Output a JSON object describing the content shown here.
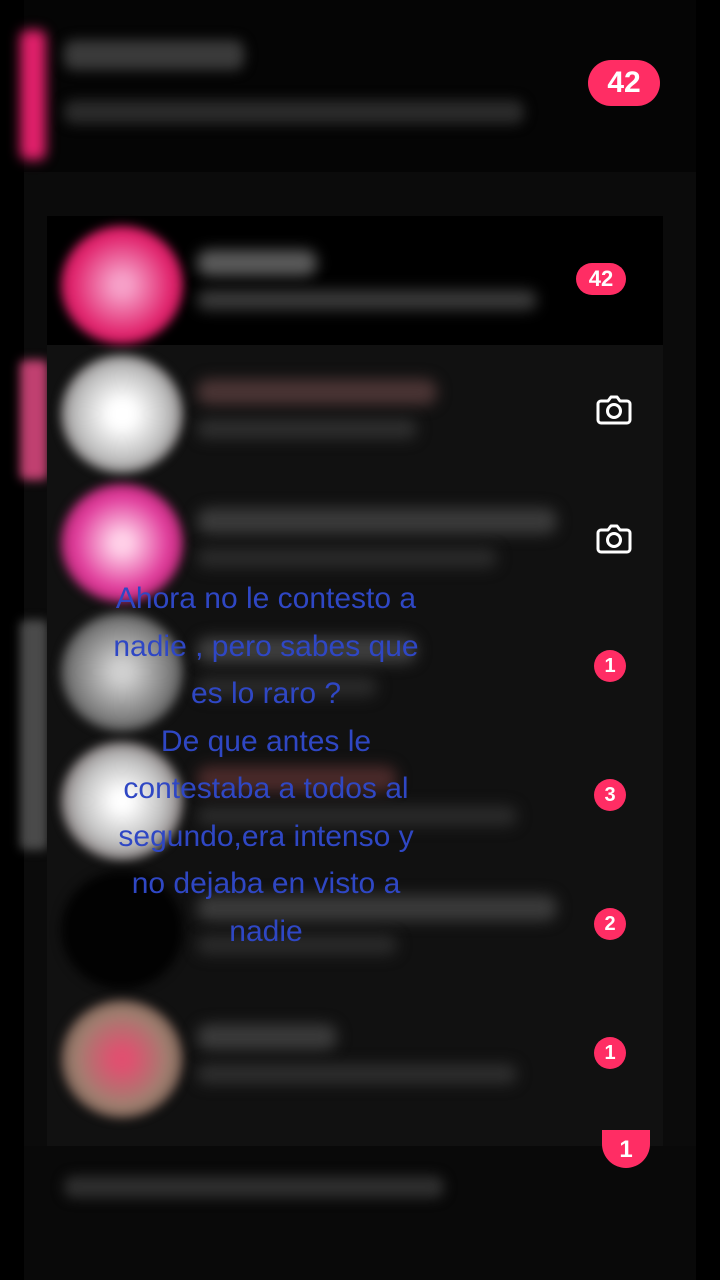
{
  "top_row": {
    "badge": "42"
  },
  "chats": [
    {
      "badge": "42",
      "indicator": "badge",
      "avatar_color": "#e0206a"
    },
    {
      "badge": "",
      "indicator": "camera-icon",
      "avatar_color": "#dcdcdc"
    },
    {
      "badge": "",
      "indicator": "camera-icon",
      "avatar_color": "#e03a9a"
    },
    {
      "badge": "1",
      "indicator": "badge",
      "avatar_color": "#9a9a9a"
    },
    {
      "badge": "3",
      "indicator": "badge",
      "avatar_color": "#d8d8d8"
    },
    {
      "badge": "2",
      "indicator": "badge",
      "avatar_color": "#050505"
    },
    {
      "badge": "1",
      "indicator": "badge",
      "avatar_color": "#b05060"
    }
  ],
  "bottom_row": {
    "badge": "1"
  },
  "caption": {
    "lines": [
      "Ahora no le contesto a",
      "nadie , pero sabes que",
      "es lo raro ?",
      "De que antes le",
      "contestaba a todos al",
      "segundo,era intenso y",
      "no dejaba en visto a",
      "nadie"
    ]
  },
  "colors": {
    "badge": "#ff2d64",
    "caption": "#2f47c4",
    "background": "#0b0b0b"
  }
}
